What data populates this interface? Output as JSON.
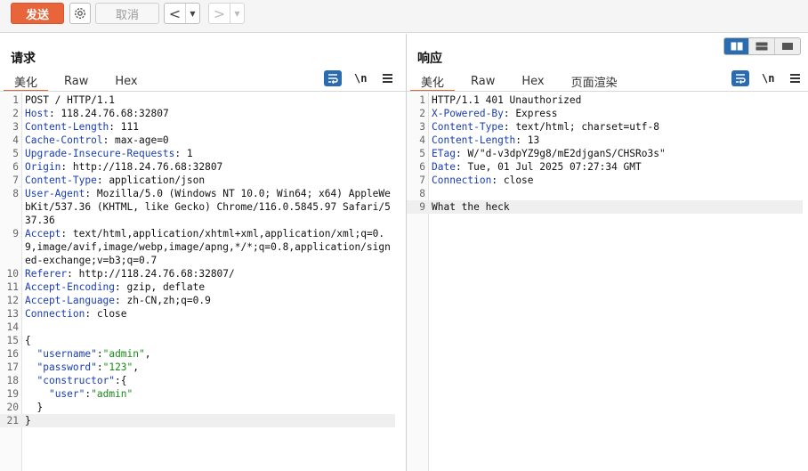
{
  "toolbar": {
    "send_label": "发送",
    "cancel_label": "取消",
    "back_glyph": "<",
    "forward_glyph": ">",
    "dropdown_glyph": "▼"
  },
  "request": {
    "title": "请求",
    "tabs": [
      {
        "label": "美化",
        "active": true
      },
      {
        "label": "Raw",
        "active": false
      },
      {
        "label": "Hex",
        "active": false
      }
    ],
    "newline_label": "\\n",
    "lines": [
      {
        "num": "1",
        "text": "POST / HTTP/1.1"
      },
      {
        "num": "2",
        "key": "Host",
        "value": "118.24.76.68:32807"
      },
      {
        "num": "3",
        "key": "Content-Length",
        "value": "111"
      },
      {
        "num": "4",
        "key": "Cache-Control",
        "value": "max-age=0"
      },
      {
        "num": "5",
        "key": "Upgrade-Insecure-Requests",
        "value": "1"
      },
      {
        "num": "6",
        "key": "Origin",
        "value": "http://118.24.76.68:32807"
      },
      {
        "num": "7",
        "key": "Content-Type",
        "value": "application/json"
      },
      {
        "num": "8",
        "key": "User-Agent",
        "value": "Mozilla/5.0 (Windows NT 10.0; Win64; x64) AppleWebKit/537.36 (KHTML, like Gecko) Chrome/116.0.5845.97 Safari/537.36",
        "rows": 3
      },
      {
        "num": "9",
        "key": "Accept",
        "value": "text/html,application/xhtml+xml,application/xml;q=0.9,image/avif,image/webp,image/apng,*/*;q=0.8,application/signed-exchange;v=b3;q=0.7",
        "rows": 4
      },
      {
        "num": "10",
        "key": "Referer",
        "value": "http://118.24.76.68:32807/"
      },
      {
        "num": "11",
        "key": "Accept-Encoding",
        "value": "gzip, deflate"
      },
      {
        "num": "12",
        "key": "Accept-Language",
        "value": "zh-CN,zh;q=0.9"
      },
      {
        "num": "13",
        "key": "Connection",
        "value": "close"
      },
      {
        "num": "14",
        "text": ""
      },
      {
        "num": "15",
        "text": "{"
      },
      {
        "num": "16",
        "indent": "  ",
        "jkey": "\"username\"",
        "jval": "\"admin\"",
        "tail": ","
      },
      {
        "num": "17",
        "indent": "  ",
        "jkey": "\"password\"",
        "jval": "\"123\"",
        "tail": ","
      },
      {
        "num": "18",
        "indent": "  ",
        "jkey": "\"constructor\"",
        "jval": "",
        "tail": "{"
      },
      {
        "num": "19",
        "indent": "    ",
        "jkey": "\"user\"",
        "jval": "\"admin\"",
        "tail": ""
      },
      {
        "num": "20",
        "text": "  }"
      },
      {
        "num": "21",
        "text": "}",
        "current": true
      }
    ]
  },
  "response": {
    "title": "响应",
    "tabs": [
      {
        "label": "美化",
        "active": true
      },
      {
        "label": "Raw",
        "active": false
      },
      {
        "label": "Hex",
        "active": false
      },
      {
        "label": "页面渲染",
        "active": false
      }
    ],
    "newline_label": "\\n",
    "lines": [
      {
        "num": "1",
        "text": "HTTP/1.1 401 Unauthorized"
      },
      {
        "num": "2",
        "key": "X-Powered-By",
        "value": "Express"
      },
      {
        "num": "3",
        "key": "Content-Type",
        "value": "text/html; charset=utf-8"
      },
      {
        "num": "4",
        "key": "Content-Length",
        "value": "13"
      },
      {
        "num": "5",
        "key": "ETag",
        "value": "W/\"d-v3dpYZ9g8/mE2djganS/CHSRo3s\""
      },
      {
        "num": "6",
        "key": "Date",
        "value": "Tue, 01 Jul 2025 07:27:34 GMT"
      },
      {
        "num": "7",
        "key": "Connection",
        "value": "close"
      },
      {
        "num": "8",
        "text": ""
      },
      {
        "num": "9",
        "text": "What the heck",
        "current": true
      }
    ]
  },
  "colors": {
    "accent": "#e8643a",
    "tool_blue": "#2b6cb0",
    "header_key": "#1a3db5",
    "json_value": "#1a8a1a"
  },
  "icons": {
    "settings": "gear-icon",
    "wrap": "word-wrap-icon",
    "menu": "hamburger-menu-icon",
    "layout_split": "layout-split-icon",
    "layout_horizontal": "layout-horizontal-icon",
    "layout_single": "layout-single-icon"
  }
}
